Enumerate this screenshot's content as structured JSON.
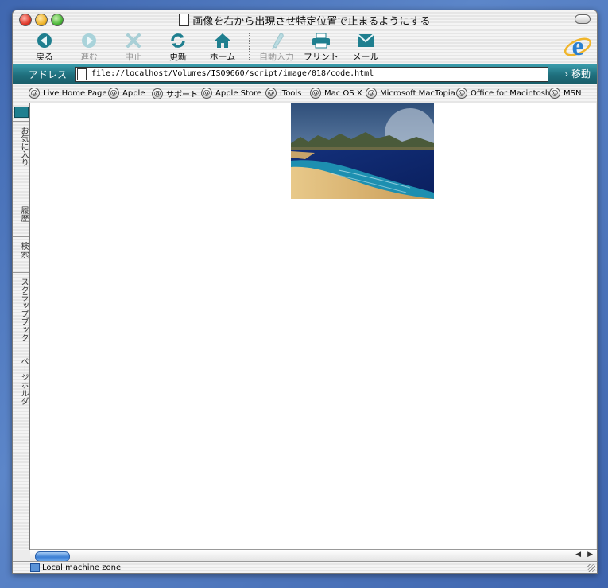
{
  "window": {
    "title": "画像を右から出現させ特定位置で止まるようにする"
  },
  "toolbar": {
    "back": "戻る",
    "forward": "進む",
    "stop": "中止",
    "refresh": "更新",
    "home": "ホーム",
    "autofill": "自動入力",
    "print": "プリント",
    "mail": "メール"
  },
  "address": {
    "label": "アドレス",
    "url": "file://localhost/Volumes/ISO9660/script/image/018/code.html",
    "go": "移動"
  },
  "favorites": [
    "Live Home Page",
    "Apple",
    "サポート",
    "Apple Store",
    "iTools",
    "Mac OS X",
    "Microsoft MacTopia",
    "Office for Macintosh",
    "MSN"
  ],
  "sidebar_tabs": [
    "お気に入り",
    "履歴",
    "検索",
    "スクラップブック",
    "ページホルダ"
  ],
  "status": {
    "zone": "Local machine zone"
  },
  "colors": {
    "accent_teal": "#1f6f7d",
    "desktop_blue": "#3f67b0"
  }
}
